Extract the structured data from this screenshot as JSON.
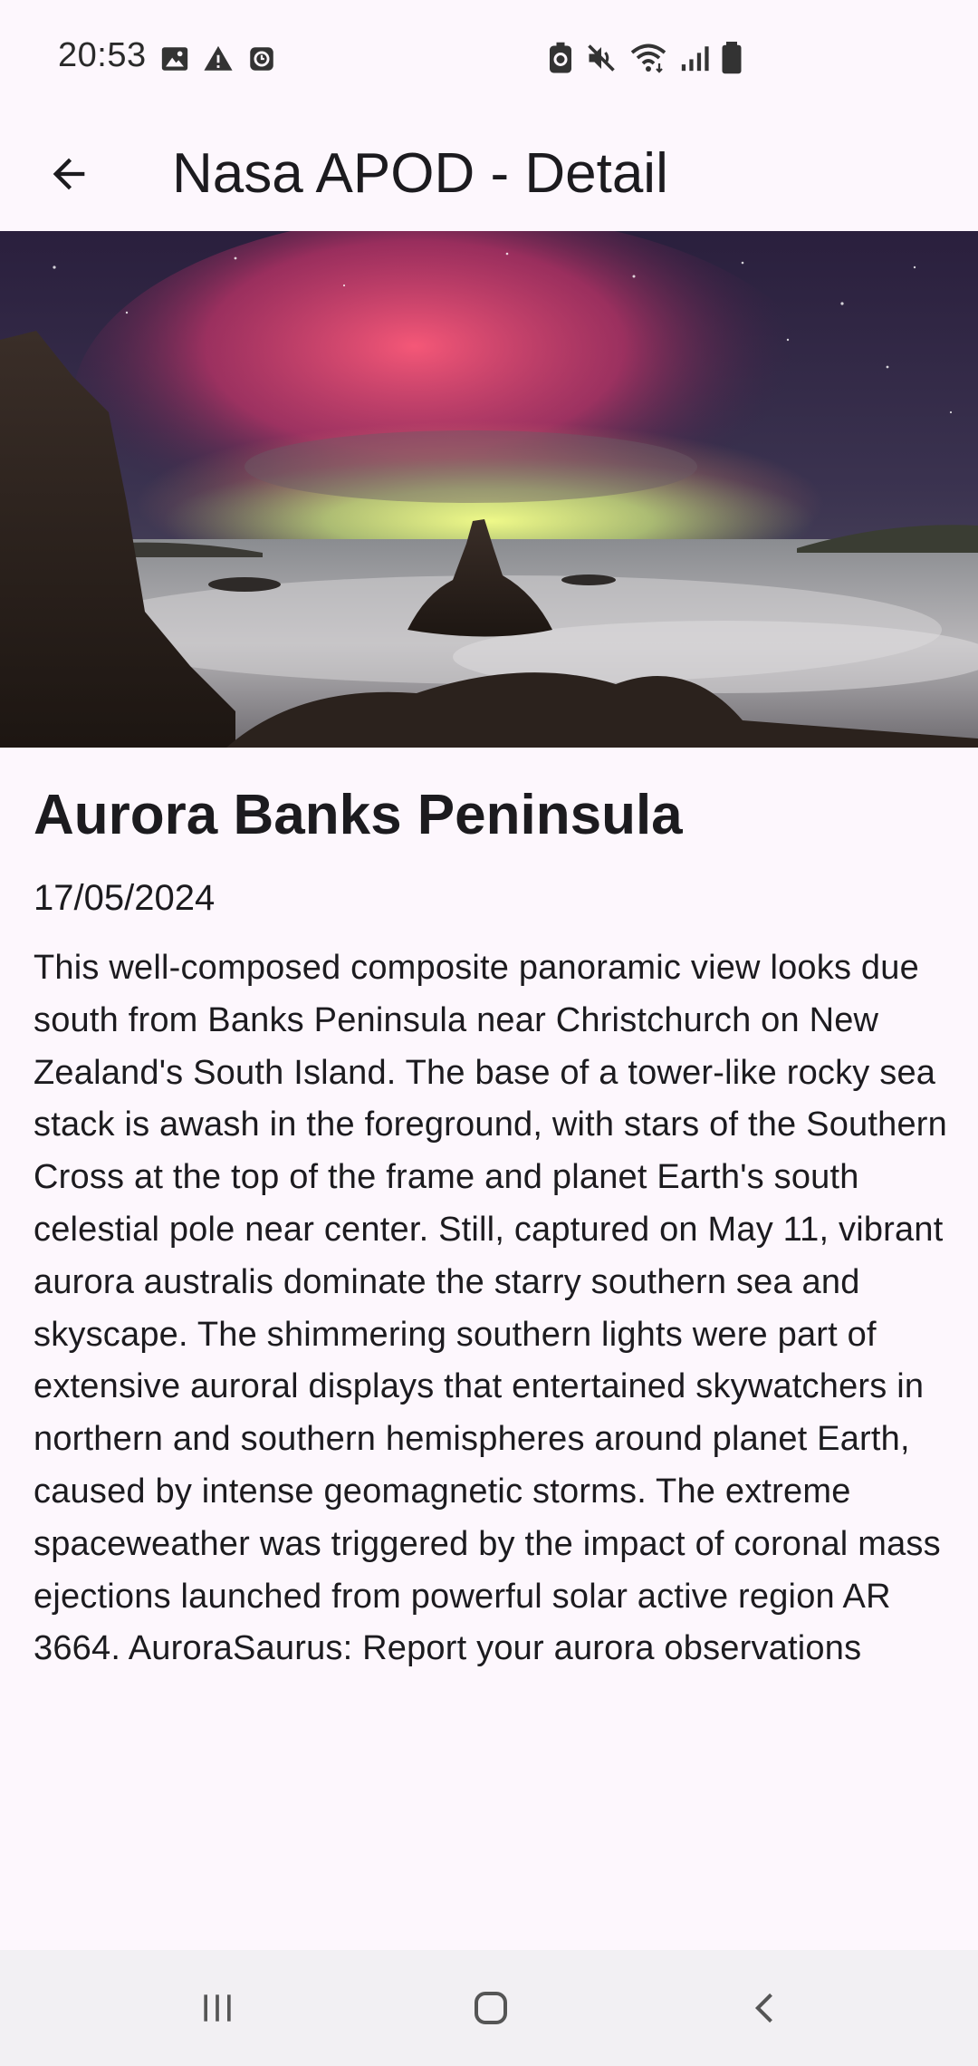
{
  "status_bar": {
    "time": "20:53",
    "left_icons": [
      "image-icon",
      "warning-icon",
      "clock-app-icon"
    ],
    "right_icons": [
      "battery-saver-icon",
      "mute-icon",
      "wifi-icon",
      "signal-icon",
      "battery-icon"
    ]
  },
  "app_bar": {
    "title": "Nasa APOD - Detail",
    "back_icon": "arrow-back-icon"
  },
  "apod": {
    "title": "Aurora Banks Peninsula",
    "date": "17/05/2024",
    "description": "This well-composed composite panoramic view looks due south from Banks Peninsula near Christchurch on New Zealand's South Island. The base of a tower-like rocky sea stack is awash in the foreground, with stars of the Southern Cross at the top of the frame and planet Earth's south celestial pole near center. Still, captured on May 11, vibrant aurora australis dominate the starry southern sea and skyscape. The shimmering southern lights were part of extensive auroral displays that entertained skywatchers in northern and southern hemispheres around planet Earth, caused by intense geomagnetic storms. The extreme spaceweather was triggered by the impact of coronal mass ejections launched from powerful solar active region AR 3664. AuroraSaurus: Report your aurora observations"
  },
  "nav_bar": {
    "buttons": [
      "recent-apps-icon",
      "home-icon",
      "back-icon"
    ]
  }
}
